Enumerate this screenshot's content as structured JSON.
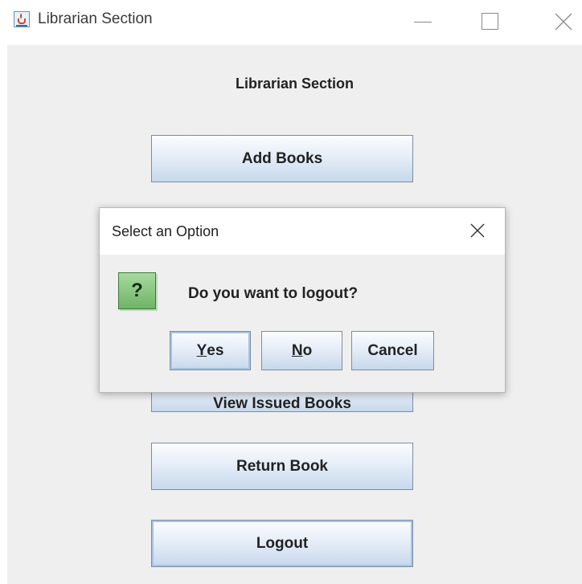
{
  "window": {
    "title": "Librarian Section",
    "icon": "java-cup-icon"
  },
  "main": {
    "heading": "Librarian Section",
    "buttons": [
      {
        "label": "Add Books"
      },
      {
        "label": "View Issued Books"
      },
      {
        "label": "Return Book"
      },
      {
        "label": "Logout"
      }
    ]
  },
  "dialog": {
    "title": "Select an Option",
    "icon": "question-icon",
    "message": "Do you want to logout?",
    "buttons": {
      "yes_mnemonic": "Y",
      "yes_rest": "es",
      "no_mnemonic": "N",
      "no_rest": "o",
      "cancel": "Cancel"
    }
  }
}
